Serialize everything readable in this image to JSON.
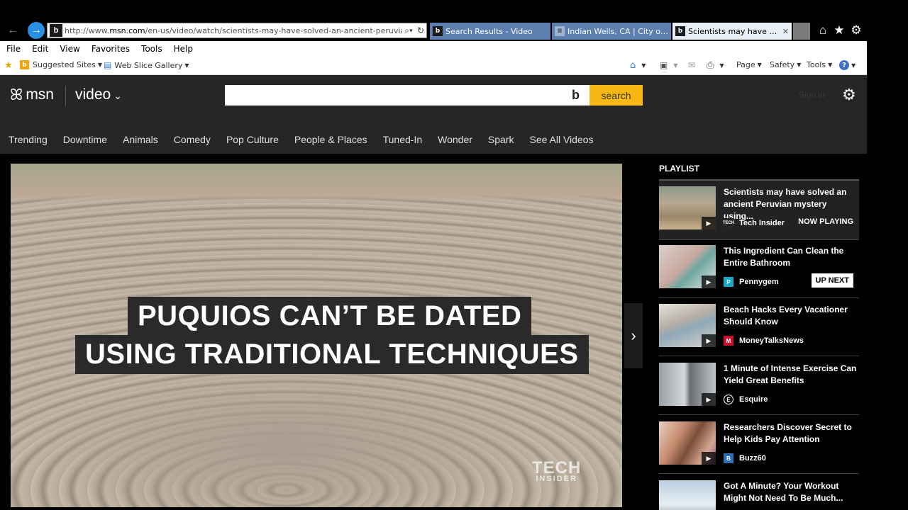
{
  "browser": {
    "url_prefix": "http://www.",
    "url_domain": "msn.com",
    "url_rest": "/en-us/video/watch/scientists-may-have-solved-an-ancient-peruvian-",
    "tabs": [
      {
        "label": "Search Results - Video",
        "favicon": "bing-favicon"
      },
      {
        "label": "Indian Wells, CA | City of In...",
        "favicon": "page-favicon"
      },
      {
        "label": "Scientists may have solv...",
        "favicon": "bing-favicon",
        "active": true
      }
    ],
    "close_glyph": "✕",
    "menu": [
      "File",
      "Edit",
      "View",
      "Favorites",
      "Tools",
      "Help"
    ],
    "favorites_bar": {
      "suggested_sites": "Suggested Sites",
      "web_slice_gallery": "Web Slice Gallery",
      "page": "Page",
      "safety": "Safety",
      "tools": "Tools"
    }
  },
  "msn": {
    "logo_text": "msn",
    "section": "video",
    "search_button": "search",
    "sign_in": "Sign in",
    "nav": [
      "Trending",
      "Downtime",
      "Animals",
      "Comedy",
      "Pop Culture",
      "People & Places",
      "Tuned-In",
      "Wonder",
      "Spark",
      "See All Videos"
    ]
  },
  "video": {
    "caption_line1": "PUQUIOS CAN’T BE DATED",
    "caption_line2": "USING TRADITIONAL TECHNIQUES",
    "watermark_line1": "TECH",
    "watermark_line2": "INSIDER"
  },
  "playlist": {
    "heading": "PLAYLIST",
    "items": [
      {
        "title": "Scientists may have solved an ancient Peruvian mystery using...",
        "source": "Tech Insider",
        "source_icon": "TECH",
        "source_color": "#262626",
        "badge": "NOW PLAYING"
      },
      {
        "title": "This Ingredient Can Clean the Entire Bathroom",
        "source": "Pennygem",
        "source_icon": "P",
        "source_color": "#1aa8c9",
        "badge": "UP NEXT"
      },
      {
        "title": "Beach Hacks Every Vacationer Should Know",
        "source": "MoneyTalksNews",
        "source_icon": "M",
        "source_color": "#c8102e",
        "badge": ""
      },
      {
        "title": "1 Minute of Intense Exercise Can Yield Great Benefits",
        "source": "Esquire",
        "source_icon": "E",
        "source_color": "#111111",
        "badge": ""
      },
      {
        "title": "Researchers Discover Secret to Help Kids Pay Attention",
        "source": "Buzz60",
        "source_icon": "B",
        "source_color": "#2d6fb7",
        "badge": ""
      },
      {
        "title": "Got A Minute? Your Workout Might Not Need To Be Much...",
        "source": "",
        "source_icon": "",
        "source_color": "#000000",
        "badge": ""
      }
    ]
  }
}
